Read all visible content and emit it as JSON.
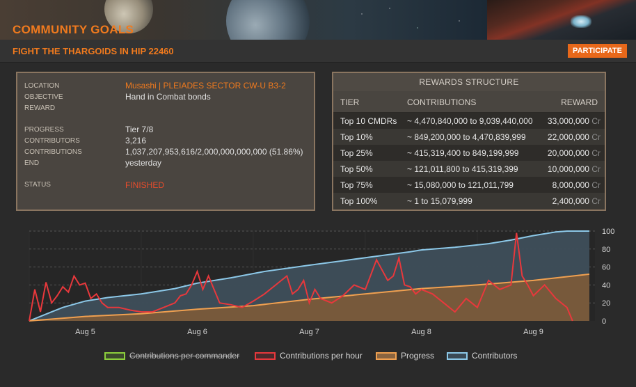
{
  "banner": {
    "title": "COMMUNITY GOALS"
  },
  "goal": {
    "title": "FIGHT THE THARGOIDS IN HIP 22460",
    "participate_label": "PARTICIPATE"
  },
  "info": {
    "location_label": "LOCATION",
    "location_value": "Musashi | PLEIADES SECTOR CW-U B3-2",
    "objective_label": "OBJECTIVE",
    "objective_value": "Hand in Combat bonds",
    "reward_label": "REWARD",
    "progress_label": "PROGRESS",
    "progress_value": "Tier 7/8",
    "contributors_label": "CONTRIBUTORS",
    "contributors_value": "3,216",
    "contributions_label": "CONTRIBUTIONS",
    "contributions_value": "1,037,207,953,616/2,000,000,000,000 (51.86%)",
    "end_label": "END",
    "end_value": "yesterday",
    "status_label": "STATUS",
    "status_value": "FINISHED"
  },
  "rewards": {
    "title": "REWARDS STRUCTURE",
    "head_tier": "TIER",
    "head_contributions": "CONTRIBUTIONS",
    "head_reward": "REWARD",
    "unit": "Cr",
    "rows": [
      {
        "tier": "Top 10 CMDRs",
        "contributions": "~ 4,470,840,000 to 9,039,440,000",
        "reward": "33,000,000"
      },
      {
        "tier": "Top 10%",
        "contributions": "~ 849,200,000 to 4,470,839,999",
        "reward": "22,000,000"
      },
      {
        "tier": "Top 25%",
        "contributions": "~ 415,319,400 to 849,199,999",
        "reward": "20,000,000"
      },
      {
        "tier": "Top 50%",
        "contributions": "~ 121,011,800 to 415,319,399",
        "reward": "10,000,000"
      },
      {
        "tier": "Top 75%",
        "contributions": "~ 15,080,000 to 121,011,799",
        "reward": "8,000,000"
      },
      {
        "tier": "Top 100%",
        "contributions": "~ 1 to 15,079,999",
        "reward": "2,400,000"
      }
    ]
  },
  "colors": {
    "accent": "#f07a1e",
    "status_finished": "#e84c2c",
    "per_commander": "#8ccf3c",
    "per_hour": "#e8383c",
    "progress": "#f0a050",
    "contributors": "#8cc8e8"
  },
  "chart_data": {
    "type": "line",
    "categories": [
      "Aug 5",
      "Aug 6",
      "Aug 7",
      "Aug 8",
      "Aug 9"
    ],
    "ylim": [
      0,
      100
    ],
    "yticks": [
      0,
      20,
      40,
      60,
      80,
      100
    ],
    "legend_position": "bottom",
    "grid": true,
    "series": [
      {
        "name": "Contributions per commander",
        "hidden": true,
        "values": []
      },
      {
        "name": "Contributions per hour",
        "x": [
          4.5,
          4.55,
          4.6,
          4.65,
          4.7,
          4.75,
          4.8,
          4.85,
          4.9,
          4.95,
          5.0,
          5.05,
          5.1,
          5.15,
          5.2,
          5.3,
          5.4,
          5.5,
          5.6,
          5.7,
          5.8,
          5.85,
          5.9,
          5.95,
          6.0,
          6.05,
          6.1,
          6.2,
          6.3,
          6.4,
          6.5,
          6.6,
          6.7,
          6.8,
          6.85,
          6.9,
          6.95,
          7.0,
          7.05,
          7.1,
          7.2,
          7.3,
          7.4,
          7.5,
          7.6,
          7.7,
          7.75,
          7.8,
          7.85,
          7.9,
          7.95,
          8.0,
          8.1,
          8.2,
          8.3,
          8.4,
          8.5,
          8.6,
          8.7,
          8.8,
          8.85,
          8.9,
          8.95,
          9.0,
          9.1,
          9.2,
          9.3,
          9.35
        ],
        "values": [
          0,
          35,
          10,
          43,
          20,
          28,
          38,
          32,
          50,
          40,
          42,
          25,
          30,
          20,
          15,
          15,
          12,
          10,
          10,
          15,
          20,
          28,
          30,
          40,
          55,
          35,
          50,
          20,
          18,
          15,
          22,
          30,
          40,
          50,
          30,
          35,
          45,
          20,
          35,
          25,
          20,
          28,
          40,
          35,
          68,
          45,
          50,
          70,
          40,
          38,
          30,
          35,
          30,
          20,
          10,
          25,
          15,
          45,
          35,
          40,
          98,
          50,
          40,
          28,
          40,
          25,
          15,
          0
        ]
      },
      {
        "name": "Progress",
        "x": [
          4.5,
          5.0,
          5.5,
          6.0,
          6.5,
          7.0,
          7.5,
          8.0,
          8.5,
          9.0,
          9.5
        ],
        "values": [
          0,
          5,
          8,
          13,
          17,
          24,
          30,
          36,
          40,
          45,
          52
        ]
      },
      {
        "name": "Contributors",
        "x": [
          4.5,
          4.6,
          4.7,
          4.8,
          5.0,
          5.2,
          5.5,
          5.8,
          6.0,
          6.3,
          6.6,
          7.0,
          7.3,
          7.6,
          7.9,
          8.0,
          8.3,
          8.6,
          8.8,
          9.0,
          9.2,
          9.3,
          9.5
        ],
        "values": [
          0,
          5,
          10,
          15,
          22,
          26,
          30,
          36,
          42,
          48,
          55,
          62,
          67,
          72,
          77,
          79,
          82,
          86,
          90,
          95,
          99,
          100,
          100
        ]
      }
    ]
  }
}
